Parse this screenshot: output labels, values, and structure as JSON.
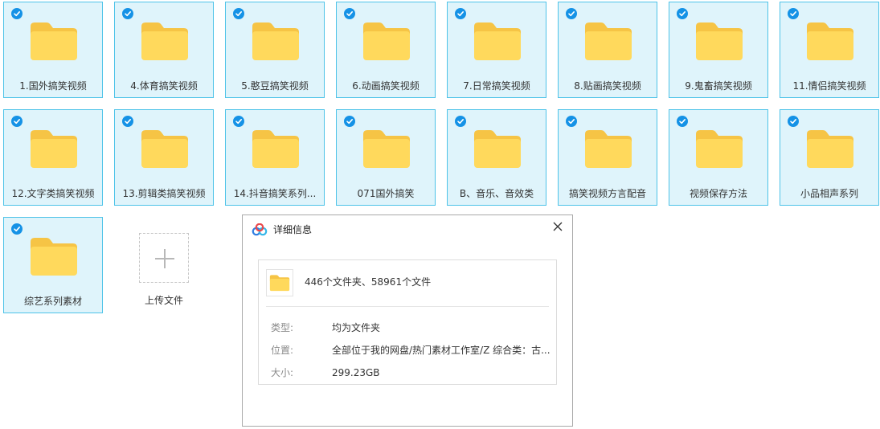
{
  "folders": [
    {
      "name": "1.国外搞笑视频"
    },
    {
      "name": "4.体育搞笑视频"
    },
    {
      "name": "5.憨豆搞笑视频"
    },
    {
      "name": "6.动画搞笑视频"
    },
    {
      "name": "7.日常搞笑视频"
    },
    {
      "name": "8.贴画搞笑视频"
    },
    {
      "name": "9.鬼畜搞笑视频"
    },
    {
      "name": "11.情侣搞笑视频"
    },
    {
      "name": "12.文字类搞笑视频"
    },
    {
      "name": "13.剪辑类搞笑视频"
    },
    {
      "name": "14.抖音搞笑系列..."
    },
    {
      "name": "071国外搞笑"
    },
    {
      "name": "B、音乐、音效类"
    },
    {
      "name": "搞笑视频方言配音"
    },
    {
      "name": "视频保存方法"
    },
    {
      "name": "小品相声系列"
    },
    {
      "name": "综艺系列素材"
    }
  ],
  "upload": {
    "label": "上传文件"
  },
  "dialog": {
    "title": "详细信息",
    "summary": "446个文件夹、58961个文件",
    "type_key": "类型:",
    "type_value": "均为文件夹",
    "location_key": "位置:",
    "location_value": "全部位于我的网盘/热门素材工作室/Z 综合类：古...",
    "size_key": "大小:",
    "size_value": "299.23GB"
  },
  "colors": {
    "tile_bg": "#dff4fb",
    "tile_border": "#4ec3e8",
    "check": "#1592e6",
    "folder_back": "#f6c445",
    "folder_front": "#ffd95c"
  },
  "icons": {
    "folder": "folder-icon",
    "check": "check-icon",
    "plus": "plus-icon",
    "close": "close-icon",
    "app": "cloud-app-icon"
  }
}
